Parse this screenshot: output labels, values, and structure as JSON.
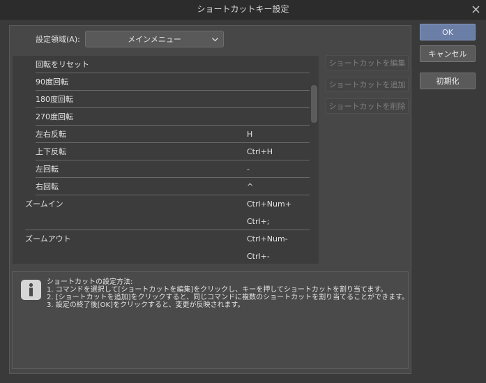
{
  "window": {
    "title": "ショートカットキー設定"
  },
  "area": {
    "label": "設定領域(A):",
    "selected": "メインメニュー"
  },
  "shortcut_list": [
    {
      "name": "回転をリセット",
      "key": "",
      "indent": 2,
      "separator": true
    },
    {
      "name": "90度回転",
      "key": "",
      "indent": 2,
      "separator": true
    },
    {
      "name": "180度回転",
      "key": "",
      "indent": 2,
      "separator": true
    },
    {
      "name": "270度回転",
      "key": "",
      "indent": 2,
      "separator": true
    },
    {
      "name": "左右反転",
      "key": "H",
      "indent": 2,
      "separator": true
    },
    {
      "name": "上下反転",
      "key": "Ctrl+H",
      "indent": 2,
      "separator": true
    },
    {
      "name": "左回転",
      "key": "-",
      "indent": 2,
      "separator": true
    },
    {
      "name": "右回転",
      "key": "^",
      "indent": 2,
      "separator": true
    },
    {
      "name": "ズームイン",
      "key": "Ctrl+Num+",
      "indent": 1,
      "separator": false
    },
    {
      "name": "",
      "key": "Ctrl+;",
      "indent": 1,
      "separator": true
    },
    {
      "name": "ズームアウト",
      "key": "Ctrl+Num-",
      "indent": 1,
      "separator": false
    },
    {
      "name": "",
      "key": "Ctrl+-",
      "indent": 1,
      "separator": false
    }
  ],
  "side_buttons": {
    "edit": "ショートカットを編集",
    "add": "ショートカットを追加",
    "delete": "ショートカットを削除"
  },
  "dialog_buttons": {
    "ok": "OK",
    "cancel": "キャンセル",
    "reset": "初期化"
  },
  "info": {
    "title": "ショートカットの設定方法:",
    "lines": [
      "1. コマンドを選択して[ショートカットを編集]をクリックし、キーを押してショートカットを割り当てます。",
      "2. [ショートカットを追加]をクリックすると、同じコマンドに複数のショートカットを割り当てることができます。",
      "3. 設定の終了後[OK]をクリックすると、変更が反映されます。"
    ]
  },
  "icons": {
    "close": "close-icon",
    "dropdown": "chevron-down-icon",
    "info": "info-icon"
  },
  "colors": {
    "primary_button": "#6a7ea6",
    "disabled_text": "#7f7f7f"
  }
}
